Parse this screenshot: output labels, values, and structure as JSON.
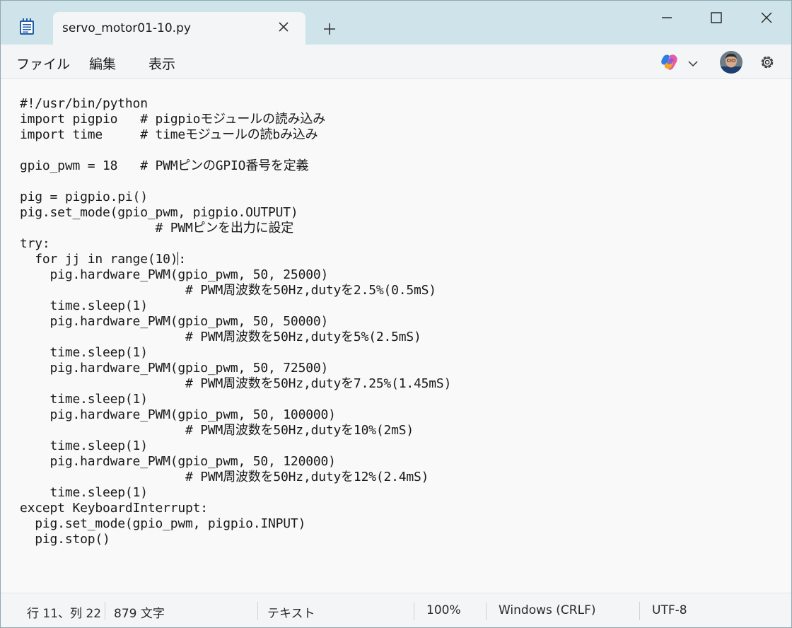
{
  "window": {
    "tab_title": "servo_motor01-10.py"
  },
  "menu": {
    "file": "ファイル",
    "edit": "編集",
    "view": "表示"
  },
  "editor": {
    "lines": [
      "#!/usr/bin/python",
      "import pigpio   # pigpioモジュールの読み込み",
      "import time     # timeモジュールの読bみ込み",
      "",
      "gpio_pwm = 18   # PWMピンのGPIO番号を定義",
      "",
      "pig = pigpio.pi()",
      "pig.set_mode(gpio_pwm, pigpio.OUTPUT)",
      "                  # PWMピンを出力に設定",
      "try:",
      "  for jj in range(10):",
      "    pig.hardware_PWM(gpio_pwm, 50, 25000)",
      "                      # PWM周波数を50Hz,dutyを2.5%(0.5mS)",
      "    time.sleep(1)",
      "    pig.hardware_PWM(gpio_pwm, 50, 50000)",
      "                      # PWM周波数を50Hz,dutyを5%(2.5mS)",
      "    time.sleep(1)",
      "    pig.hardware_PWM(gpio_pwm, 50, 72500)",
      "                      # PWM周波数を50Hz,dutyを7.25%(1.45mS)",
      "    time.sleep(1)",
      "    pig.hardware_PWM(gpio_pwm, 50, 100000)",
      "                      # PWM周波数を50Hz,dutyを10%(2mS)",
      "    time.sleep(1)",
      "    pig.hardware_PWM(gpio_pwm, 50, 120000)",
      "                      # PWM周波数を50Hz,dutyを12%(2.4mS)",
      "    time.sleep(1)",
      "except KeyboardInterrupt:",
      "  pig.set_mode(gpio_pwm, pigpio.INPUT)",
      "  pig.stop()"
    ],
    "caret_line": 11,
    "caret_col": 22
  },
  "status": {
    "position": "行 11、列 22",
    "char_count": "879 文字",
    "format": "テキスト",
    "zoom": "100%",
    "line_ending": "Windows (CRLF)",
    "encoding": "UTF-8"
  },
  "colors": {
    "titlebar": "#cfe3ea",
    "accent": "#0067c0"
  },
  "icons": {
    "app": "notepad-icon",
    "close_tab": "close-icon",
    "new_tab": "plus-icon",
    "minimize": "minimize-icon",
    "maximize": "maximize-icon",
    "close_window": "close-icon",
    "copilot": "copilot-icon",
    "dropdown": "chevron-down-icon",
    "settings": "gear-icon"
  }
}
